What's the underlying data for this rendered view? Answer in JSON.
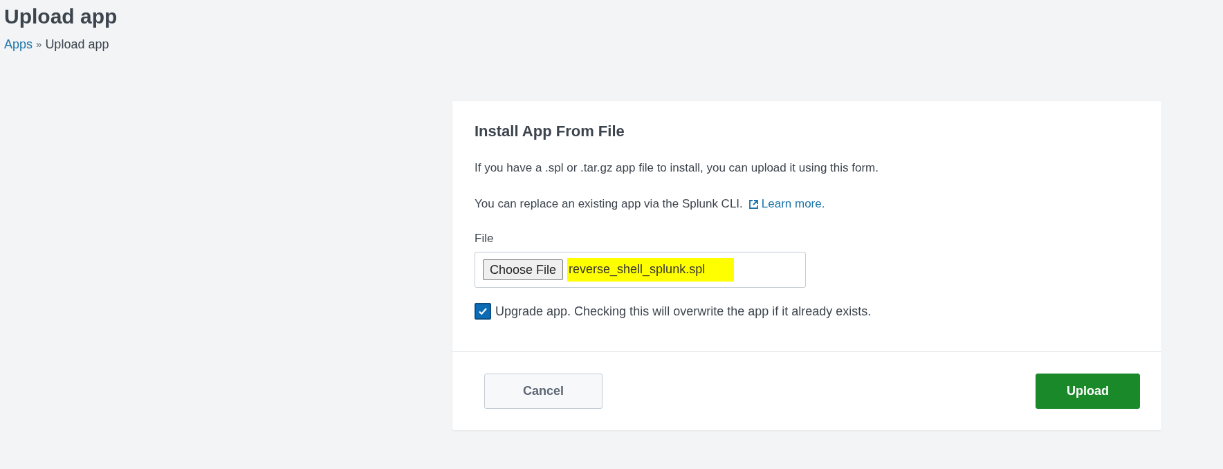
{
  "page": {
    "title": "Upload app"
  },
  "breadcrumb": [
    {
      "label": "Apps",
      "kind": "link"
    },
    {
      "label": "»",
      "kind": "separator"
    },
    {
      "label": "Upload app",
      "kind": "current"
    }
  ],
  "card": {
    "title": "Install App From File",
    "description": "If you have a .spl or .tar.gz app file to install, you can upload it using this form.",
    "replace_note": "You can replace an existing app via the Splunk CLI.",
    "learn_more": "Learn more.",
    "file_label": "File",
    "choose_button": "Choose File",
    "file_name": "reverse_shell_splunk.spl",
    "file_name_highlighted": true,
    "upgrade": {
      "label": "Upgrade app. Checking this will overwrite the app if it already exists.",
      "checked": true
    },
    "buttons": [
      {
        "label": "Cancel",
        "kind": "secondary"
      },
      {
        "label": "Upload",
        "kind": "primary"
      }
    ]
  }
}
